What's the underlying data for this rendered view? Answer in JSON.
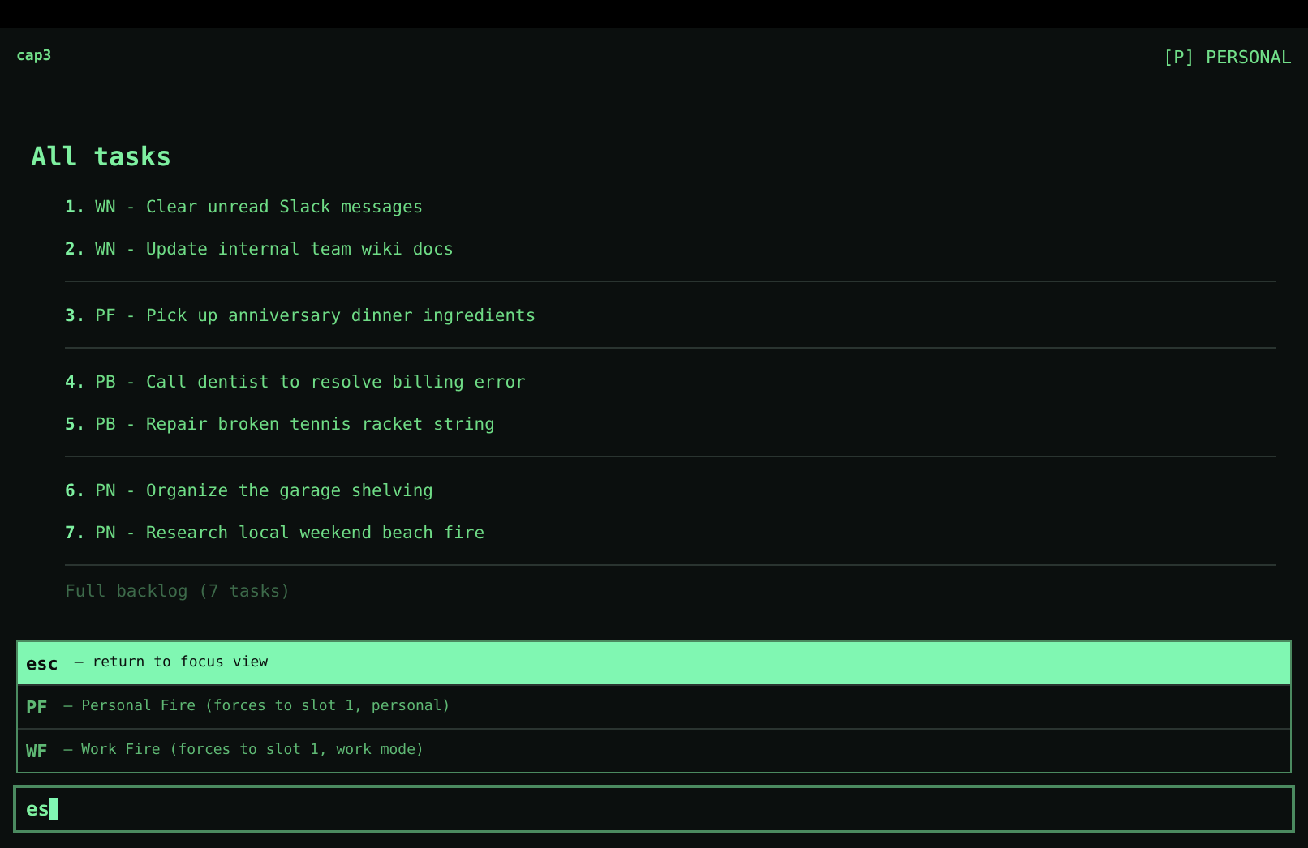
{
  "header": {
    "app_name": "cap3",
    "mode": "[P] PERSONAL"
  },
  "title": "All tasks",
  "task_groups": [
    {
      "tasks": [
        {
          "number": "1.",
          "code": "WN",
          "text": "- Clear unread Slack messages"
        },
        {
          "number": "2.",
          "code": "WN",
          "text": "- Update internal team wiki docs"
        }
      ]
    },
    {
      "tasks": [
        {
          "number": "3.",
          "code": "PF",
          "text": "- Pick up anniversary dinner ingredients"
        }
      ]
    },
    {
      "tasks": [
        {
          "number": "4.",
          "code": "PB",
          "text": "- Call dentist to resolve billing error"
        },
        {
          "number": "5.",
          "code": "PB",
          "text": "- Repair broken tennis racket string"
        }
      ]
    },
    {
      "tasks": [
        {
          "number": "6.",
          "code": "PN",
          "text": "- Organize the garage shelving"
        },
        {
          "number": "7.",
          "code": "PN",
          "text": "- Research local weekend beach fire"
        }
      ]
    }
  ],
  "backlog_note": "Full backlog (7 tasks)",
  "suggestions": [
    {
      "key": "esc",
      "description": "— return to focus view",
      "selected": true
    },
    {
      "key": "PF",
      "description": "— Personal Fire (forces to slot 1, personal)",
      "selected": false
    },
    {
      "key": "WF",
      "description": "— Work Fire (forces to slot 1, work mode)",
      "selected": false
    }
  ],
  "command_input": {
    "value": "es"
  }
}
